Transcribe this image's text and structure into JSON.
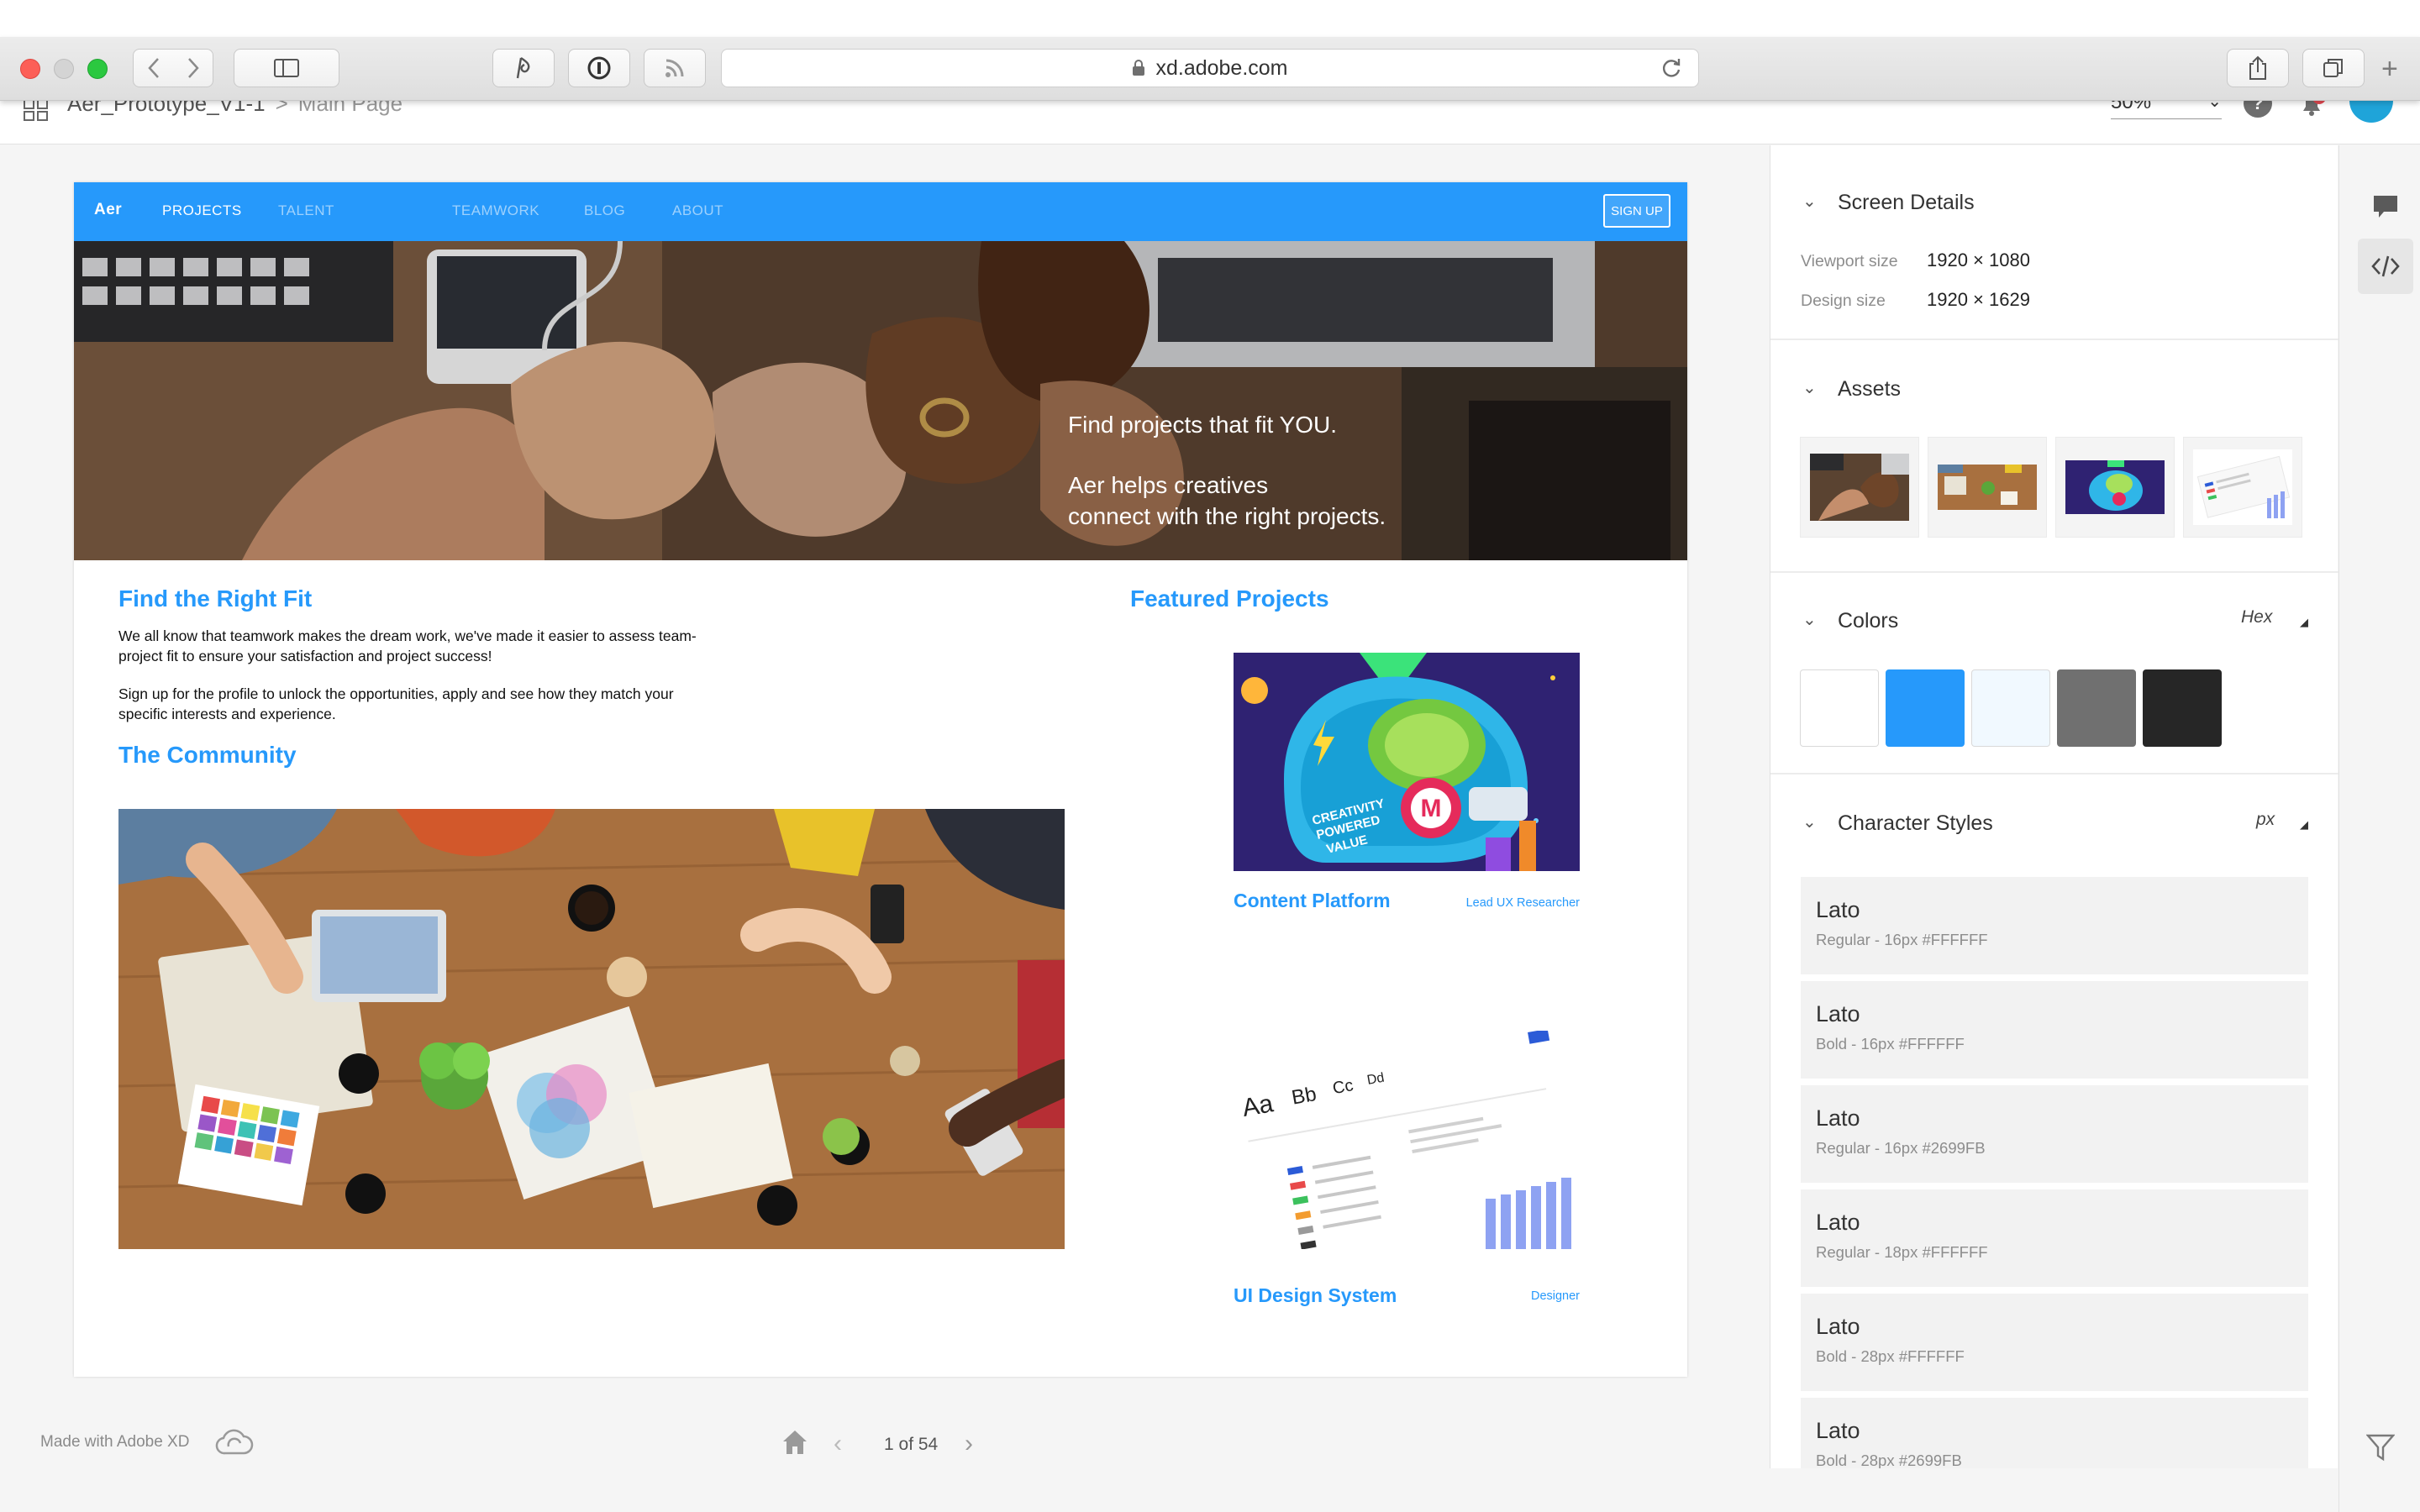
{
  "browser": {
    "url": "xd.adobe.com"
  },
  "xd_header": {
    "project": "Aer_Prototype_V1-1",
    "separator": ">",
    "page": "Main Page",
    "zoom": "50%"
  },
  "site": {
    "nav": {
      "logo": "Aer",
      "items": [
        "PROJECTS",
        "TALENT",
        "TEAMWORK",
        "BLOG",
        "ABOUT"
      ],
      "signup": "SIGN UP"
    },
    "hero": {
      "line1": "Find projects that fit YOU.",
      "line2": "Aer helps creatives",
      "line3": "connect with the right projects."
    },
    "find_fit": {
      "title": "Find the Right Fit",
      "para1": "We all know that teamwork makes the dream work, we've made it easier to assess team-project fit to ensure your satisfaction and project success!",
      "para2": "Sign up for the profile to unlock the opportunities, apply and see how they match your specific interests and experience."
    },
    "community": {
      "title": "The Community"
    },
    "featured": {
      "title": "Featured Projects",
      "projects": [
        {
          "title": "Content Platform",
          "role": "Lead UX Researcher"
        },
        {
          "title": "UI Design System",
          "role": "Designer"
        }
      ]
    }
  },
  "footer_nav": {
    "made_with": "Made with Adobe XD",
    "page_count": "1 of 54"
  },
  "panel": {
    "screen_details": {
      "title": "Screen Details",
      "viewport_label": "Viewport size",
      "viewport_value": "1920 × 1080",
      "design_label": "Design size",
      "design_value": "1920 × 1629"
    },
    "assets": {
      "title": "Assets"
    },
    "colors": {
      "title": "Colors",
      "format": "Hex",
      "swatches": [
        "#FFFFFF",
        "#2699FB",
        "#F1F9FF",
        "#707070",
        "#262626"
      ]
    },
    "character_styles": {
      "title": "Character Styles",
      "unit": "px",
      "styles": [
        {
          "font": "Lato",
          "desc": "Regular - 16px #FFFFFF"
        },
        {
          "font": "Lato",
          "desc": "Bold - 16px #FFFFFF"
        },
        {
          "font": "Lato",
          "desc": "Regular - 16px #2699FB"
        },
        {
          "font": "Lato",
          "desc": "Regular - 18px #FFFFFF"
        },
        {
          "font": "Lato",
          "desc": "Bold - 28px #FFFFFF"
        },
        {
          "font": "Lato",
          "desc": "Bold - 28px #2699FB"
        }
      ]
    }
  },
  "icons": {
    "toolbar": [
      "chevron-left-icon",
      "chevron-right-icon",
      "sidebar-icon",
      "highlight-icon",
      "password-icon",
      "rss-icon",
      "lock-icon",
      "reload-icon",
      "share-icon",
      "tabs-icon",
      "plus-icon"
    ],
    "rail": [
      "comment-icon",
      "code-icon",
      "filter-icon"
    ]
  },
  "colors": {
    "accent": "#2699FB"
  }
}
